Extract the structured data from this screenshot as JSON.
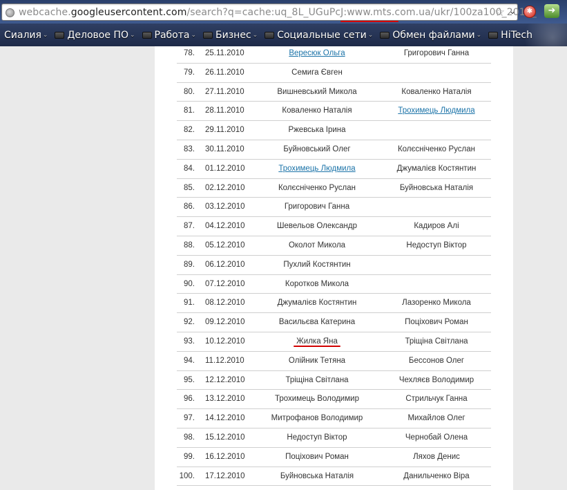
{
  "browser": {
    "url_prefix": "webcache.",
    "url_host": "googleusercontent.com",
    "url_rest": "/search?q=cache:uq_8L_UGuPcJ:www.mts.com.ua/ukr/100za100_2010_",
    "bookmark_star": "☆",
    "dropdown_glyph": "⌄"
  },
  "bookmarks": [
    {
      "label": "Сиалия"
    },
    {
      "label": "Деловое ПО"
    },
    {
      "label": "Работа"
    },
    {
      "label": "Бизнес"
    },
    {
      "label": "Социальные сети"
    },
    {
      "label": "Обмен файлами"
    },
    {
      "label": "HiTech"
    }
  ],
  "table": {
    "rows": [
      {
        "num": "78.",
        "date": "25.11.2010",
        "p1": "Вересюк Ольга",
        "p1_link": true,
        "p2": "Григорович Ганна",
        "p2_link": false
      },
      {
        "num": "79.",
        "date": "26.11.2010",
        "p1": "Семига Євген",
        "p1_link": false,
        "p2": "",
        "p2_link": false
      },
      {
        "num": "80.",
        "date": "27.11.2010",
        "p1": "Вишневський Микола",
        "p1_link": false,
        "p2": "Коваленко Наталія",
        "p2_link": false
      },
      {
        "num": "81.",
        "date": "28.11.2010",
        "p1": "Коваленко Наталія",
        "p1_link": false,
        "p2": "Трохимець Людмила",
        "p2_link": true
      },
      {
        "num": "82.",
        "date": "29.11.2010",
        "p1": "Ржевська Ірина",
        "p1_link": false,
        "p2": "",
        "p2_link": false
      },
      {
        "num": "83.",
        "date": "30.11.2010",
        "p1": "Буйновський Олег",
        "p1_link": false,
        "p2": "Колєсніченко Руслан",
        "p2_link": false
      },
      {
        "num": "84.",
        "date": "01.12.2010",
        "p1": "Трохимець Людмила",
        "p1_link": true,
        "p2": "Джумалієв Костянтин",
        "p2_link": false
      },
      {
        "num": "85.",
        "date": "02.12.2010",
        "p1": "Колєсніченко Руслан",
        "p1_link": false,
        "p2": "Буйновська Наталія",
        "p2_link": false
      },
      {
        "num": "86.",
        "date": "03.12.2010",
        "p1": "Григорович Ганна",
        "p1_link": false,
        "p2": "",
        "p2_link": false
      },
      {
        "num": "87.",
        "date": "04.12.2010",
        "p1": "Шевельов Олександр",
        "p1_link": false,
        "p2": "Кадиров Алі",
        "p2_link": false
      },
      {
        "num": "88.",
        "date": "05.12.2010",
        "p1": "Околот Микола",
        "p1_link": false,
        "p2": "Недоступ Віктор",
        "p2_link": false
      },
      {
        "num": "89.",
        "date": "06.12.2010",
        "p1": "Пухлий Костянтин",
        "p1_link": false,
        "p2": "",
        "p2_link": false
      },
      {
        "num": "90.",
        "date": "07.12.2010",
        "p1": "Коротков Микола",
        "p1_link": false,
        "p2": "",
        "p2_link": false
      },
      {
        "num": "91.",
        "date": "08.12.2010",
        "p1": "Джумалієв Костянтин",
        "p1_link": false,
        "p2": "Лазоренко Микола",
        "p2_link": false
      },
      {
        "num": "92.",
        "date": "09.12.2010",
        "p1": "Васильєва Катерина",
        "p1_link": false,
        "p2": "Поціхович Роман",
        "p2_link": false
      },
      {
        "num": "93.",
        "date": "10.12.2010",
        "p1": "Жилка Яна",
        "p1_link": false,
        "p2": "Тріщіна Світлана",
        "p2_link": false,
        "highlight": true
      },
      {
        "num": "94.",
        "date": "11.12.2010",
        "p1": "Олійник Тетяна",
        "p1_link": false,
        "p2": "Бессонов Олег",
        "p2_link": false
      },
      {
        "num": "95.",
        "date": "12.12.2010",
        "p1": "Тріщіна Світлана",
        "p1_link": false,
        "p2": "Чехляєв Володимир",
        "p2_link": false
      },
      {
        "num": "96.",
        "date": "13.12.2010",
        "p1": "Трохимець Володимир",
        "p1_link": false,
        "p2": "Стрильчук Ганна",
        "p2_link": false
      },
      {
        "num": "97.",
        "date": "14.12.2010",
        "p1": "Митрофанов Володимир",
        "p1_link": false,
        "p2": "Михайлов Олег",
        "p2_link": false
      },
      {
        "num": "98.",
        "date": "15.12.2010",
        "p1": "Недоступ Віктор",
        "p1_link": false,
        "p2": "Чернобай Олена",
        "p2_link": false
      },
      {
        "num": "99.",
        "date": "16.12.2010",
        "p1": "Поціхович Роман",
        "p1_link": false,
        "p2": "Ляхов Денис",
        "p2_link": false
      },
      {
        "num": "100.",
        "date": "17.12.2010",
        "p1": "Буйновська Наталія",
        "p1_link": false,
        "p2": "Данильченко Віра",
        "p2_link": false
      }
    ]
  },
  "colors": {
    "link": "#1b73a8",
    "annotation_red": "#d10000"
  }
}
